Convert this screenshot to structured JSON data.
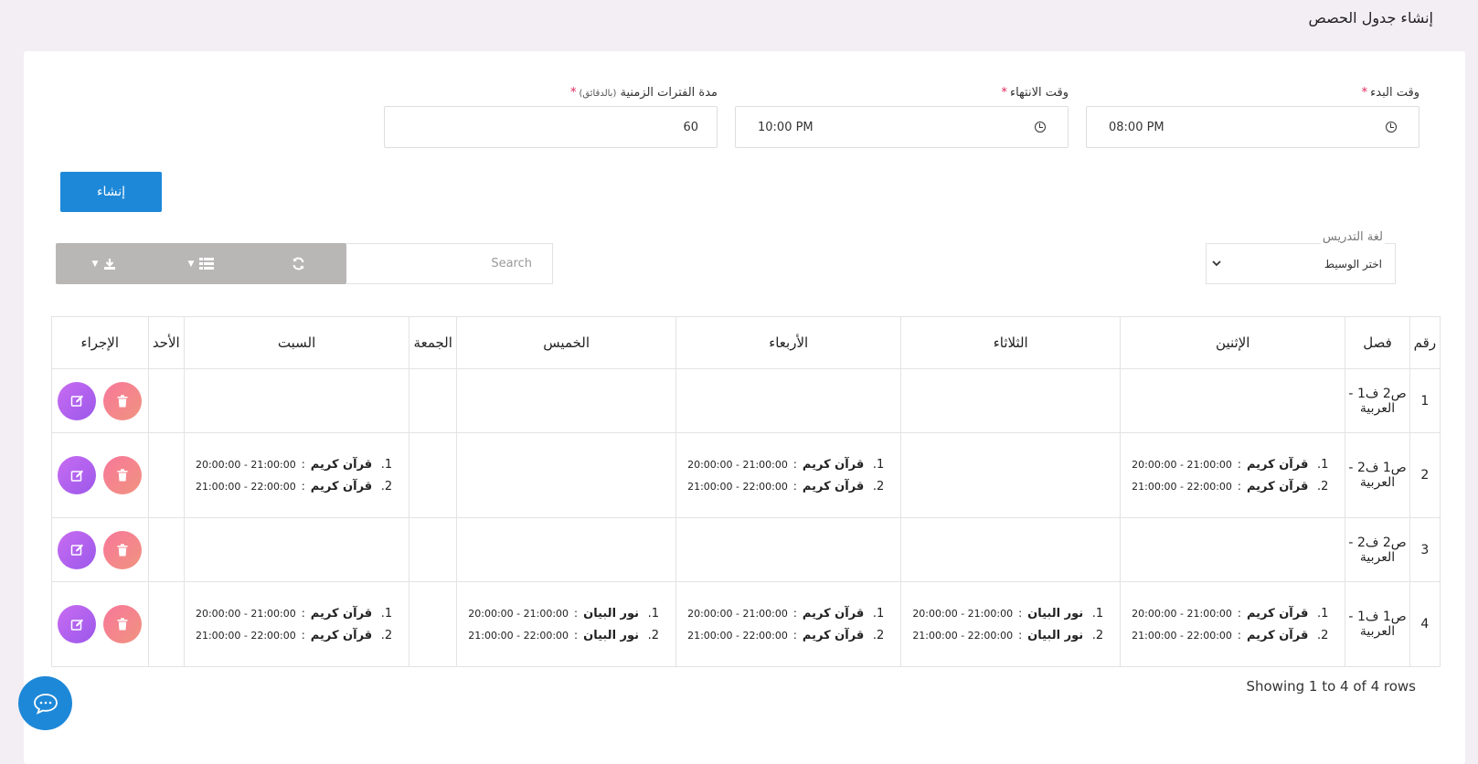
{
  "page": {
    "title": "إنشاء جدول الحصص"
  },
  "form": {
    "start_label": "وقت البدء",
    "start_value": "08:00 PM",
    "end_label": "وقت الانتهاء",
    "end_value": "10:00 PM",
    "duration_label": "مدة الفترات الزمنية",
    "duration_hint": "(بالدقائق)",
    "duration_value": "60",
    "required_mark": "*",
    "create_label": "إنشاء"
  },
  "filter": {
    "lang_label": "لغة التدريس",
    "lang_value": "اختر الوسيط",
    "search_placeholder": "Search"
  },
  "table": {
    "headers": [
      "رقم",
      "فصل",
      "الإثنين",
      "الثلاثاء",
      "الأربعاء",
      "الخميس",
      "الجمعة",
      "السبت",
      "الأحد",
      "الإجراء"
    ],
    "rows": [
      {
        "num": "1",
        "class": "ص2 ف1 - العربية",
        "days": [
          [],
          [],
          [],
          [],
          [],
          [],
          []
        ]
      },
      {
        "num": "2",
        "class": "ص1 ف2 - العربية",
        "days": [
          [
            {
              "subject": "قرآن كريم",
              "time": "20:00:00 - 21:00:00"
            },
            {
              "subject": "قرآن كريم",
              "time": "21:00:00 - 22:00:00"
            }
          ],
          [],
          [
            {
              "subject": "قرآن كريم",
              "time": "20:00:00 - 21:00:00"
            },
            {
              "subject": "قرآن كريم",
              "time": "21:00:00 - 22:00:00"
            }
          ],
          [],
          [],
          [
            {
              "subject": "قرآن كريم",
              "time": "20:00:00 - 21:00:00"
            },
            {
              "subject": "قرآن كريم",
              "time": "21:00:00 - 22:00:00"
            }
          ],
          []
        ]
      },
      {
        "num": "3",
        "class": "ص2 ف2 - العربية",
        "days": [
          [],
          [],
          [],
          [],
          [],
          [],
          []
        ]
      },
      {
        "num": "4",
        "class": "ص1 ف1 - العربية",
        "days": [
          [
            {
              "subject": "قرآن كريم",
              "time": "20:00:00 - 21:00:00"
            },
            {
              "subject": "قرآن كريم",
              "time": "21:00:00 - 22:00:00"
            }
          ],
          [
            {
              "subject": "نور البيان",
              "time": "20:00:00 - 21:00:00"
            },
            {
              "subject": "نور البيان",
              "time": "21:00:00 - 22:00:00"
            }
          ],
          [
            {
              "subject": "قرآن كريم",
              "time": "20:00:00 - 21:00:00"
            },
            {
              "subject": "قرآن كريم",
              "time": "21:00:00 - 22:00:00"
            }
          ],
          [
            {
              "subject": "نور البيان",
              "time": "20:00:00 - 21:00:00"
            },
            {
              "subject": "نور البيان",
              "time": "21:00:00 - 22:00:00"
            }
          ],
          [],
          [
            {
              "subject": "قرآن كريم",
              "time": "20:00:00 - 21:00:00"
            },
            {
              "subject": "قرآن كريم",
              "time": "21:00:00 - 22:00:00"
            }
          ],
          []
        ]
      }
    ],
    "footer": "Showing 1 to 4 of 4 rows"
  },
  "icons": {
    "clock": "clock-icon",
    "refresh": "refresh-icon",
    "columns": "list-icon",
    "export": "download-icon",
    "chevron": "chevron-down-icon",
    "edit": "edit-icon",
    "delete": "trash-icon",
    "chat": "chat-icon"
  },
  "colors": {
    "primary": "#1e88d8",
    "toolbar": "#b9b6b6",
    "edit_gradient": "#9b58ea",
    "delete_gradient": "#f8789a",
    "required": "#e0245e"
  }
}
